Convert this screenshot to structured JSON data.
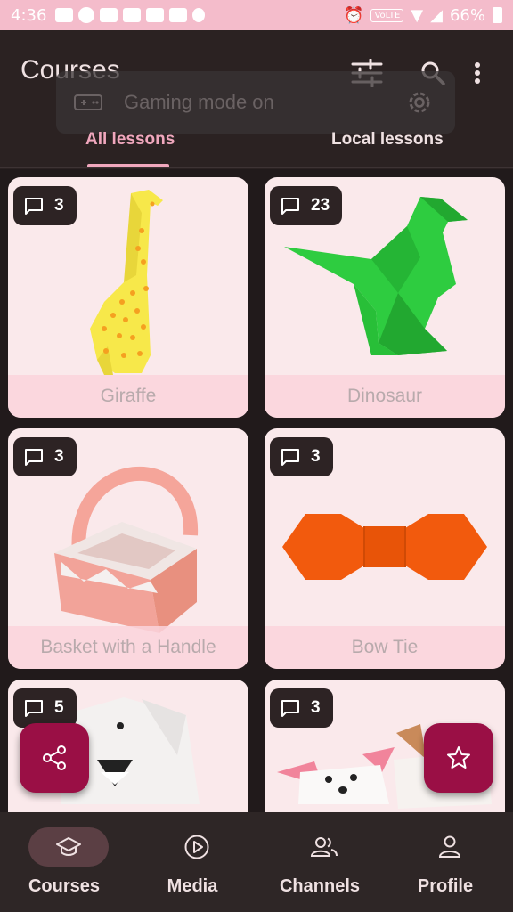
{
  "status_bar": {
    "time": "4:36",
    "volte": "VoLTE",
    "battery": "66%"
  },
  "app_bar": {
    "title": "Courses",
    "toast": "Gaming mode on"
  },
  "tabs": [
    {
      "label": "All lessons",
      "selected": true
    },
    {
      "label": "Local lessons",
      "selected": false
    }
  ],
  "lessons": [
    {
      "title": "Giraffe",
      "comments": "3"
    },
    {
      "title": "Dinosaur",
      "comments": "23"
    },
    {
      "title": "Basket with a Handle",
      "comments": "3"
    },
    {
      "title": "Bow Tie",
      "comments": "3"
    },
    {
      "title": "",
      "comments": "5"
    },
    {
      "title": "",
      "comments": "3"
    }
  ],
  "bottom_nav": [
    {
      "label": "Courses",
      "icon": "graduation-cap-icon",
      "active": true
    },
    {
      "label": "Media",
      "icon": "play-circle-icon",
      "active": false
    },
    {
      "label": "Channels",
      "icon": "people-icon",
      "active": false
    },
    {
      "label": "Profile",
      "icon": "person-icon",
      "active": false
    }
  ],
  "colors": {
    "accent": "#f0a7bd",
    "fab": "#9a0f45",
    "background": "#211a1b"
  }
}
